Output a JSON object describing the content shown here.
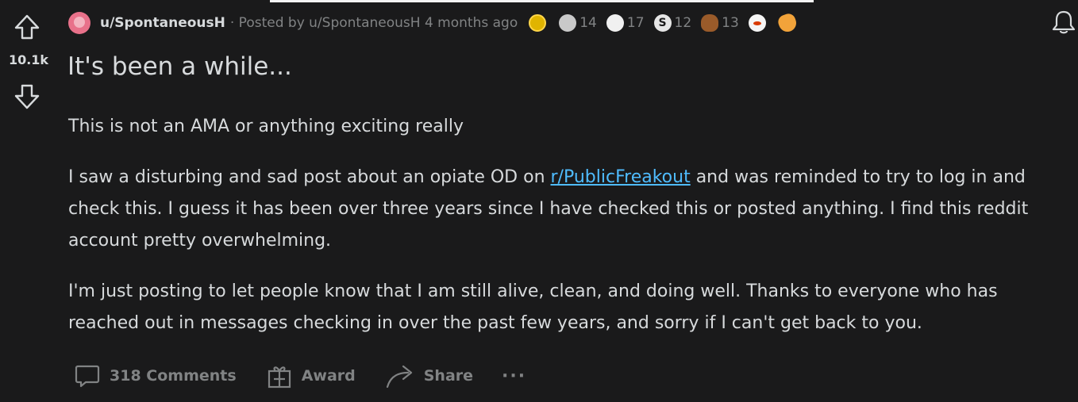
{
  "post": {
    "score": "10.1k",
    "author": "u/SpontaneousH",
    "posted_by": "· Posted by u/SpontaneousH 4 months ago",
    "title": "It's been a while...",
    "awards": [
      {
        "icon": "gold-award-icon",
        "count": ""
      },
      {
        "icon": "silver-award-icon",
        "count": "14"
      },
      {
        "icon": "wholesome-award-icon",
        "count": "17"
      },
      {
        "icon": "s-award-icon",
        "count": "12"
      },
      {
        "icon": "poop-award-icon",
        "count": "13"
      },
      {
        "icon": "snoo-award-icon",
        "count": ""
      },
      {
        "icon": "hand-award-icon",
        "count": ""
      }
    ],
    "body": {
      "p1": "This is not an AMA or anything exciting really",
      "p2_before": "I saw a disturbing and sad post about an opiate OD on ",
      "p2_link": "r/PublicFreakout",
      "p2_after": " and was reminded to try to log in and check this. I guess it has been over three years since I have checked this or posted anything. I find this reddit account pretty overwhelming.",
      "p3": "I'm just posting to let people know that I am still alive, clean, and doing well. Thanks to everyone who has reached out in messages checking in over the past few years, and sorry if I can't get back to you."
    },
    "actions": {
      "comments": "318 Comments",
      "award": "Award",
      "share": "Share",
      "more": "···"
    }
  },
  "colors": {
    "background": "#1a1a1b",
    "text": "#d7dadc",
    "muted": "#818384",
    "link": "#4fbcff"
  }
}
